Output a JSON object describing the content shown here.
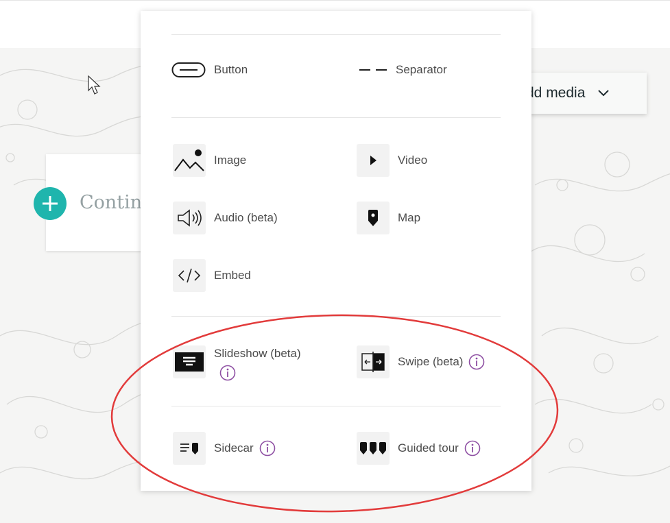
{
  "toolbar": {
    "add_media_label": "dd media"
  },
  "story": {
    "continue_placeholder": "Contin"
  },
  "insert_menu": {
    "button": {
      "label": "Button",
      "icon": "button-shape-icon"
    },
    "separator": {
      "label": "Separator",
      "icon": "separator-icon"
    },
    "image": {
      "label": "Image",
      "icon": "image-icon"
    },
    "video": {
      "label": "Video",
      "icon": "video-icon"
    },
    "audio": {
      "label": "Audio (beta)",
      "icon": "speaker-icon"
    },
    "map": {
      "label": "Map",
      "icon": "map-pin-icon"
    },
    "embed": {
      "label": "Embed",
      "icon": "code-icon"
    },
    "slideshow": {
      "label": "Slideshow (beta)",
      "icon": "slideshow-icon"
    },
    "swipe": {
      "label": "Swipe (beta)",
      "icon": "swipe-icon"
    },
    "sidecar": {
      "label": "Sidecar",
      "icon": "sidecar-icon"
    },
    "guided_tour": {
      "label": "Guided tour",
      "icon": "guided-tour-icon"
    }
  },
  "colors": {
    "accent_teal": "#1fb5ad",
    "info_purple": "#8e4fa3",
    "annotation_red": "#e23b3b"
  }
}
